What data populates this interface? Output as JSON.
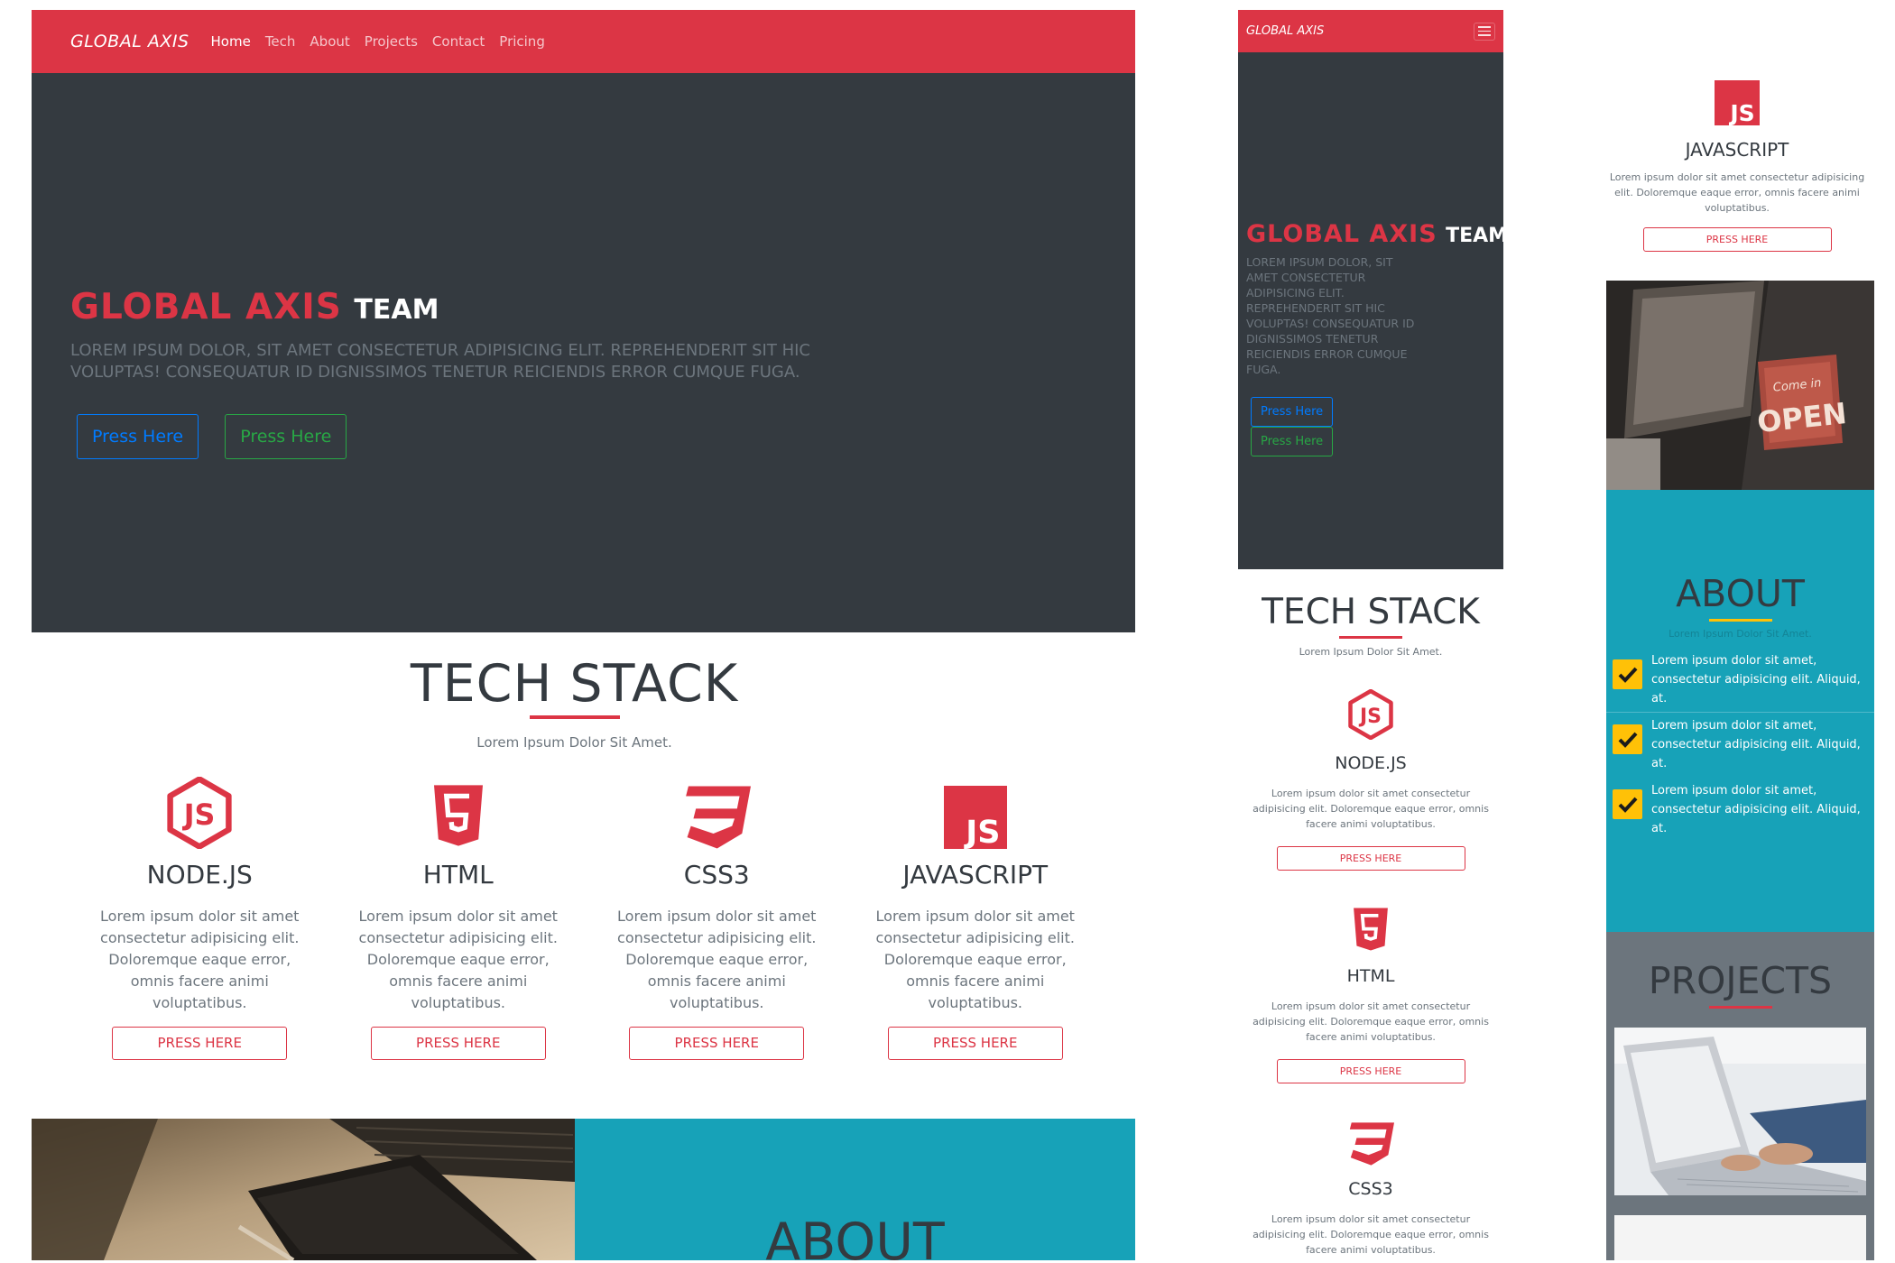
{
  "brand": "GLOBAL AXIS",
  "nav": {
    "links": [
      "Home",
      "Tech",
      "About",
      "Projects",
      "Contact",
      "Pricing"
    ]
  },
  "hero": {
    "title_main": "GLOBAL AXIS",
    "title_sub": "TEAM",
    "text": "Lorem ipsum dolor, sit amet consectetur adipisicing elit. Reprehenderit sit hic voluptas! Consequatur id dignissimos tenetur reiciendis error cumque fuga.",
    "buttons": [
      "Press Here",
      "Press Here"
    ]
  },
  "tech": {
    "title": "TECH STACK",
    "subtitle": "Lorem Ipsum Dolor Sit Amet.",
    "cards": [
      {
        "name": "NODE.JS",
        "icon": "nodejs-icon",
        "text": "Lorem ipsum dolor sit amet consectetur adipisicing elit. Doloremque eaque error, omnis facere animi voluptatibus.",
        "button": "Press Here"
      },
      {
        "name": "HTML",
        "icon": "html5-icon",
        "text": "Lorem ipsum dolor sit amet consectetur adipisicing elit. Doloremque eaque error, omnis facere animi voluptatibus.",
        "button": "Press Here"
      },
      {
        "name": "CSS3",
        "icon": "css3-icon",
        "text": "Lorem ipsum dolor sit amet consectetur adipisicing elit. Doloremque eaque error, omnis facere animi voluptatibus.",
        "button": "Press Here"
      },
      {
        "name": "JAVASCRIPT",
        "icon": "javascript-icon",
        "text": "Lorem ipsum dolor sit amet consectetur adipisicing elit. Doloremque eaque error, omnis facere animi voluptatibus.",
        "button": "Press Here"
      }
    ]
  },
  "about": {
    "title": "ABOUT",
    "subtitle": "Lorem Ipsum Dolor Sit Amet.",
    "items": [
      "Lorem ipsum dolor sit amet, consectetur adipisicing elit. Aliquid, at.",
      "Lorem ipsum dolor sit amet, consectetur adipisicing elit. Aliquid, at.",
      "Lorem ipsum dolor sit amet, consectetur adipisicing elit. Aliquid, at."
    ]
  },
  "projects": {
    "title": "PROJECTS"
  },
  "images": {
    "desk": "desk-photo",
    "open_sign": "open-sign-photo",
    "laptop": "laptop-photo"
  },
  "colors": {
    "primary": "#dc3545",
    "dark": "#343a40",
    "teal": "#17a2b8",
    "gray": "#6c757d",
    "yellow": "#ffc107",
    "blue": "#007bff",
    "green": "#28a745"
  }
}
